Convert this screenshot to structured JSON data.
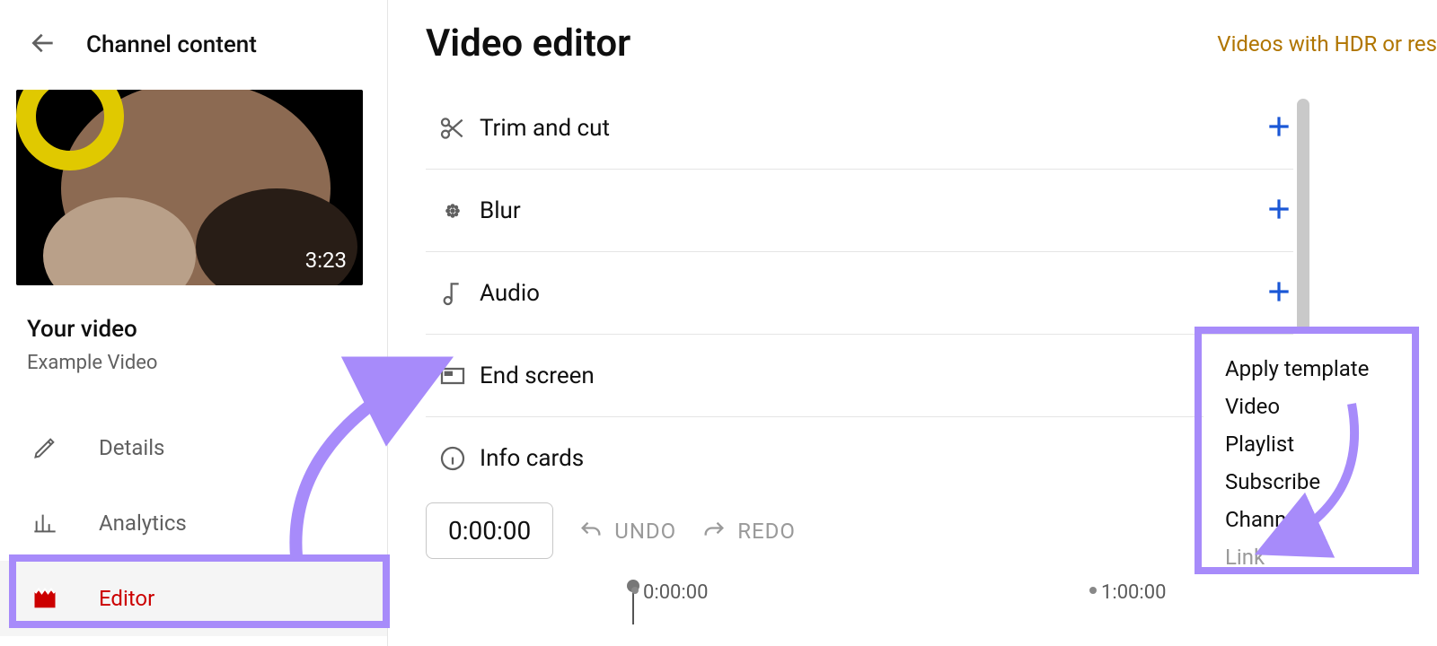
{
  "sidebar": {
    "header_title": "Channel content",
    "thumb_duration": "3:23",
    "your_video_label": "Your video",
    "video_name": "Example Video",
    "nav": {
      "details": "Details",
      "analytics": "Analytics",
      "editor": "Editor"
    }
  },
  "main": {
    "title": "Video editor",
    "hdr_link": "Videos with HDR or res",
    "tools": {
      "trim": "Trim and cut",
      "blur": "Blur",
      "audio": "Audio",
      "end_screen": "End screen",
      "info_cards": "Info cards"
    },
    "time_display": "0:00:00",
    "undo": "UNDO",
    "redo": "REDO",
    "ruler": {
      "t0": "0:00:00",
      "t1": "1:00:00"
    }
  },
  "menu": {
    "apply_template": "Apply template",
    "video": "Video",
    "playlist": "Playlist",
    "subscribe": "Subscribe",
    "channel": "Channel",
    "link": "Link"
  }
}
